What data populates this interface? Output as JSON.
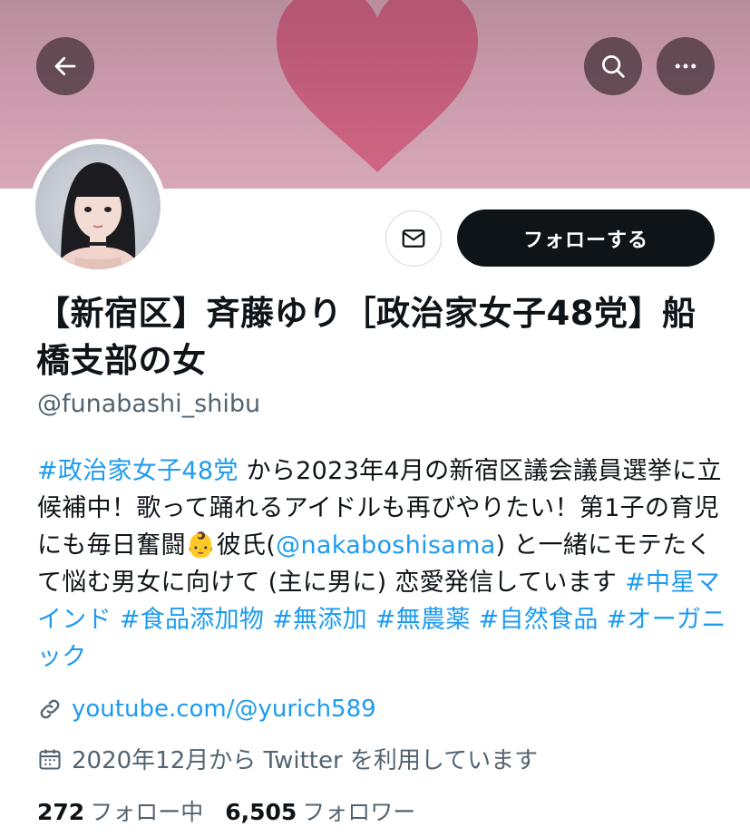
{
  "header": {
    "back_icon": "arrow-left-icon",
    "search_icon": "search-icon",
    "more_icon": "more-horizontal-icon",
    "banner_colors": [
      "#b88d9c",
      "#d7a8b8"
    ],
    "heart_color": "#c45c7c"
  },
  "actions": {
    "message_icon": "envelope-icon",
    "follow_label": "フォローする"
  },
  "profile": {
    "display_name": "【新宿区】斉藤ゆり［政治家女子48党】船橋支部の女",
    "handle": "@funabashi_shibu",
    "bio": {
      "tag1": "#政治家女子48党",
      "text1": " から2023年4月の新宿区議会議員選挙に立候補中！歌って踊れるアイドルも再びやりたい！第1子の育児にも毎日奮闘",
      "emoji": "👶",
      "text2": "彼氏(",
      "mention": "@nakaboshisama",
      "text3": ") と一緒にモテたくて悩む男女に向けて (主に男に) 恋愛発信しています ",
      "tags": "#中星マインド #食品添加物 #無添加 #無農薬 #自然食品 #オーガニック"
    },
    "url": "youtube.com/@yurich589",
    "joined": "2020年12月から Twitter を利用しています",
    "following_count": "272",
    "following_label": "フォロー中",
    "followers_count": "6,505",
    "followers_label": "フォロワー"
  },
  "colors": {
    "link": "#1d9bf0",
    "follow_bg": "#0f1419",
    "secondary_text": "#536471"
  }
}
